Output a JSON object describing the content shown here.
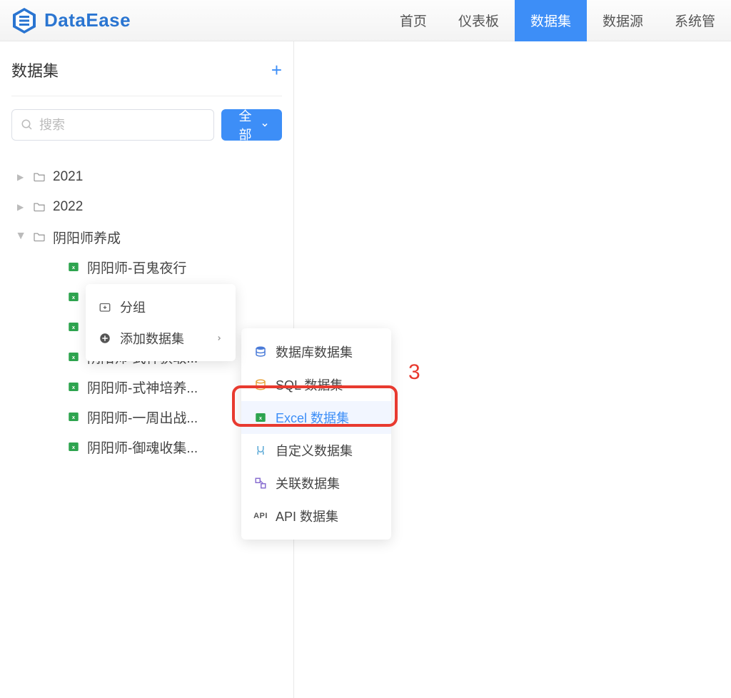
{
  "header": {
    "brand": "DataEase",
    "nav": [
      {
        "label": "首页"
      },
      {
        "label": "仪表板"
      },
      {
        "label": "数据集",
        "active": true
      },
      {
        "label": "数据源"
      },
      {
        "label": "系统管"
      }
    ]
  },
  "sidebar": {
    "title": "数据集",
    "search_placeholder": "搜索",
    "all_button": "全部"
  },
  "tree": {
    "folders": [
      {
        "name": "2021",
        "expanded": false
      },
      {
        "name": "2022",
        "expanded": false
      }
    ],
    "expanded_folder": {
      "name": "阴阳师养成",
      "children": [
        "阴阳师-百鬼夜行",
        "",
        "",
        "阴阳师-式神获取...",
        "阴阳师-式神培养...",
        "阴阳师-一周出战...",
        "阴阳师-御魂收集..."
      ]
    }
  },
  "context_menu_1": {
    "items": [
      {
        "label": "分组",
        "icon": "folder-plus-icon"
      },
      {
        "label": "添加数据集",
        "icon": "plus-circle-icon",
        "submenu": true
      }
    ]
  },
  "context_menu_2": {
    "items": [
      {
        "label": "数据库数据集",
        "icon": "database-icon"
      },
      {
        "label": "SQL 数据集",
        "icon": "sql-icon"
      },
      {
        "label": "Excel 数据集",
        "icon": "excel-icon",
        "hover": true
      },
      {
        "label": "自定义数据集",
        "icon": "custom-icon"
      },
      {
        "label": "关联数据集",
        "icon": "relation-icon"
      },
      {
        "label": "API 数据集",
        "icon": "api-icon"
      }
    ]
  },
  "annotation": {
    "number": "3"
  }
}
